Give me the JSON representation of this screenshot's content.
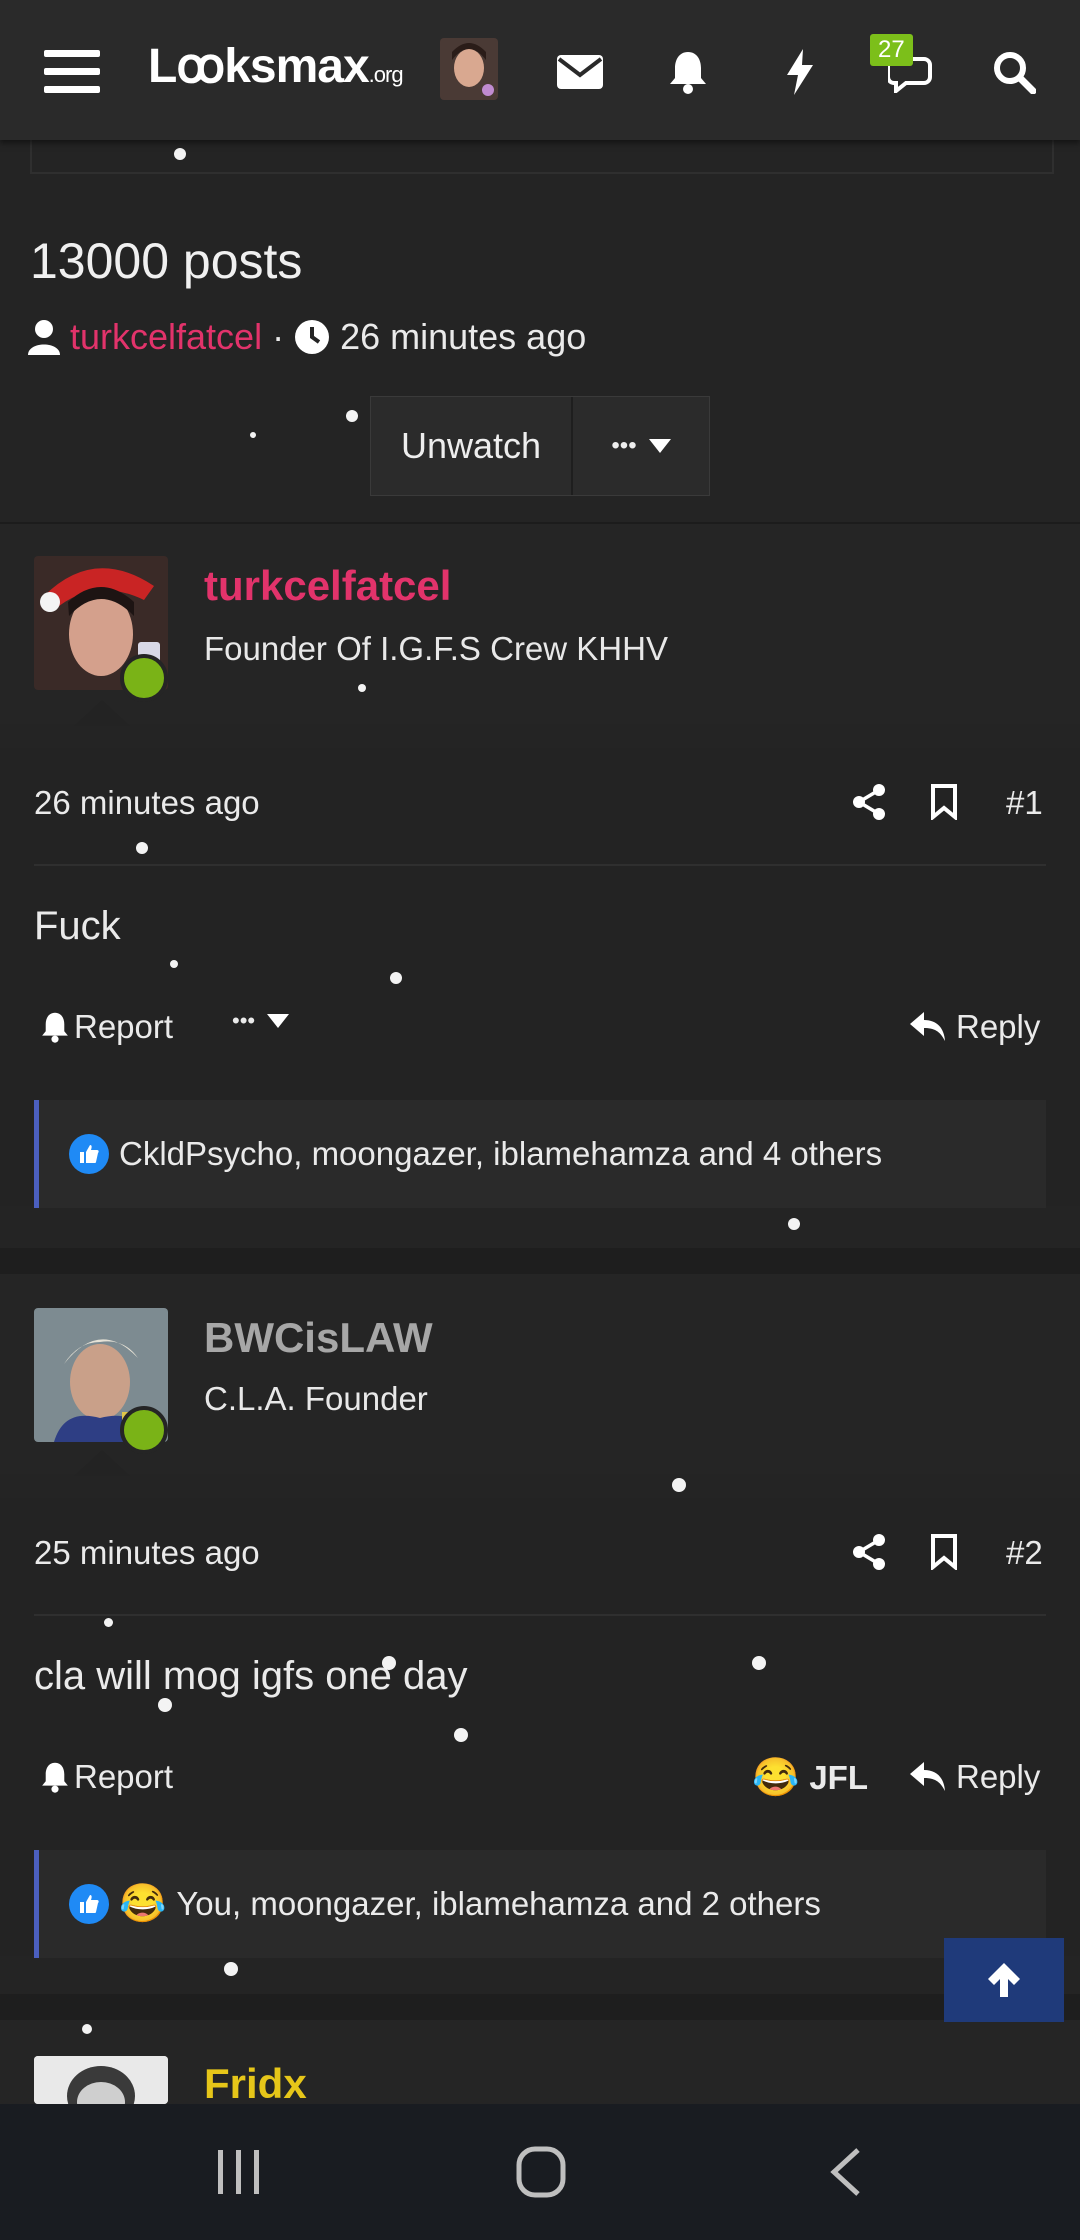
{
  "header": {
    "logo_text": "Lꝏksmax",
    "logo_suffix": ".org",
    "chat_badge": "27"
  },
  "thread": {
    "title": "13000 posts",
    "author": "turkcelfatcel",
    "separator": "·",
    "time": "26 minutes ago",
    "unwatch_label": "Unwatch",
    "more_label": "•••"
  },
  "posts": [
    {
      "username": "turkcelfatcel",
      "user_title": "Founder Of I.G.F.S Crew KHHV",
      "time": "26 minutes ago",
      "number": "#1",
      "content": "Fuck",
      "report_label": "Report",
      "more_label": "•••",
      "reply_label": "Reply",
      "reactions_text": "CkldPsycho, moongazer, iblamehamza and 4 others",
      "username_color": "#e2336b"
    },
    {
      "username": "BWCisLAW",
      "user_title": "C.L.A. Founder",
      "time": "25 minutes ago",
      "number": "#2",
      "content": "cla will mog igfs one day",
      "report_label": "Report",
      "jfl_label": "JFL",
      "reply_label": "Reply",
      "reactions_text": "You, moongazer, iblamehamza and 2 others",
      "username_color": "#a7a7a7"
    },
    {
      "username": "Fridx",
      "username_color": "#e6c619"
    }
  ],
  "colors": {
    "accent_pink": "#e2336b",
    "online": "#7ab317",
    "reaction_border": "#4b5fbf",
    "scroll_top_bg": "#1f3a7a"
  }
}
